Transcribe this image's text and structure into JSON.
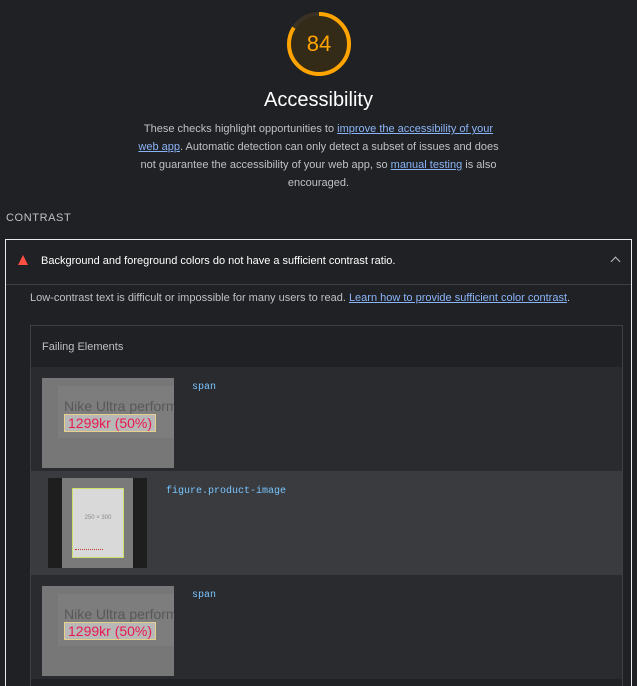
{
  "score": {
    "value": "84",
    "fraction": 0.84,
    "color": "#ffa400"
  },
  "category": {
    "title": "Accessibility",
    "desc_before": "These checks highlight opportunities to ",
    "link1": "improve the accessibility of your web app",
    "desc_middle": ". Automatic detection can only detect a subset of issues and does not guarantee the accessibility of your web app, so ",
    "link2": "manual testing",
    "desc_after": " is also encouraged."
  },
  "group": {
    "label": "CONTRAST"
  },
  "audit": {
    "title": "Background and foreground colors do not have a sufficient contrast ratio.",
    "desc_text": "Low-contrast text is difficult or impossible for many users to read. ",
    "desc_link": "Learn how to provide sufficient color contrast",
    "desc_end": ".",
    "status_color": "#ff4e42",
    "failing_title": "Failing Elements",
    "items": [
      {
        "selector": "span",
        "thumb_product": "Nike Ultra perform",
        "thumb_price": "1299kr (50%)"
      },
      {
        "selector": "figure.product-image",
        "thumb_img_label": "250 × 300"
      },
      {
        "selector": "span",
        "thumb_product": "Nike Ultra perform",
        "thumb_price": "1299kr (50%)"
      }
    ]
  }
}
